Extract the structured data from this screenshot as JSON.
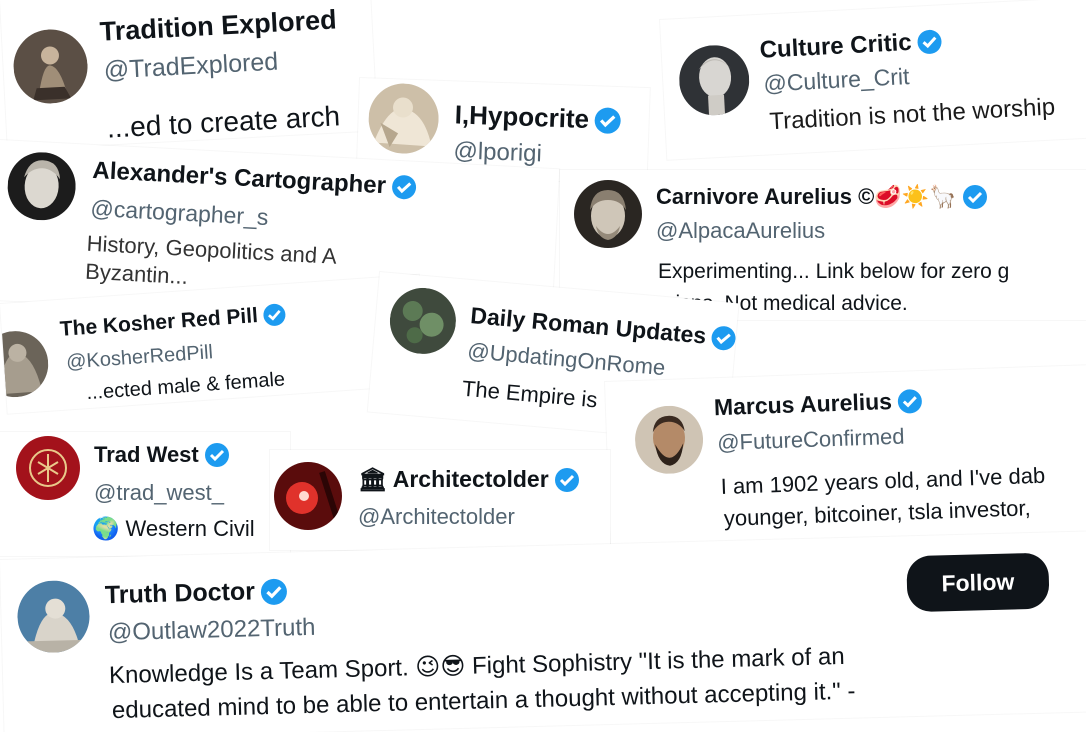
{
  "accent_color": "#1d9bf0",
  "profiles": {
    "tradition_explored": {
      "name": "Tradition Explored",
      "handle": "@TradExplored",
      "bio": "...ed to create arch",
      "verified": false,
      "avatar": "statue-avatar"
    },
    "culture_critic": {
      "name": "Culture Critic",
      "handle": "@Culture_Crit",
      "bio": "Tradition is not the worship",
      "verified": true,
      "avatar": "david-statue-avatar"
    },
    "hypocrite": {
      "name": "I,Hypocrite",
      "handle": "@lporigi",
      "verified": true,
      "avatar": "marble-sculpture-avatar"
    },
    "alexander": {
      "name": "Alexander's Cartographer",
      "handle": "@cartographer_s",
      "bio_line1": "History, Geopolitics and A",
      "bio_line2": "Byzantin...",
      "verified": true,
      "avatar": "alexander-bust-avatar"
    },
    "carnivore": {
      "name": "Carnivore Aurelius ©🥩☀️🦙",
      "handle": "@AlpacaAurelius",
      "bio_line1": "Experimenting... Link below for zero g",
      "bio_line2": "crisps. Not medical advice.",
      "verified": true,
      "avatar": "aurelius-bust-avatar"
    },
    "kosher": {
      "name": "The Kosher Red Pill",
      "handle": "@KosherRedPill",
      "bio": "...ected male & female",
      "verified": true,
      "avatar": "classical-figure-avatar"
    },
    "daily_roman": {
      "name": "Daily Roman Updates",
      "handle": "@UpdatingOnRome",
      "bio": "The Empire is",
      "verified": true,
      "avatar": "green-texture-avatar"
    },
    "marcus": {
      "name": "Marcus Aurelius",
      "handle": "@FutureConfirmed",
      "bio_line1": "I am 1902 years old, and I've dab",
      "bio_line2": "younger, bitcoiner, tsla investor,",
      "verified": true,
      "avatar": "bearded-man-avatar"
    },
    "trad_west": {
      "name": "Trad West",
      "handle": "@trad_west_",
      "bio": "🌍 Western Civil",
      "verified": true,
      "avatar": "trad-west-emblem-avatar"
    },
    "architectolder": {
      "name": "🏛 Architectolder",
      "handle": "@Architectolder",
      "verified": true,
      "avatar": "red-light-avatar"
    },
    "truth_doctor": {
      "name": "Truth Doctor",
      "handle": "@Outlaw2022Truth",
      "bio_line1": "Knowledge Is a Team Sport. 😉😎 Fight Sophistry \"It is the mark of an",
      "bio_line2": "educated mind to be able to entertain a thought without accepting it.\" -",
      "verified": true,
      "follow_label": "Follow",
      "avatar": "thinker-statue-avatar"
    }
  }
}
